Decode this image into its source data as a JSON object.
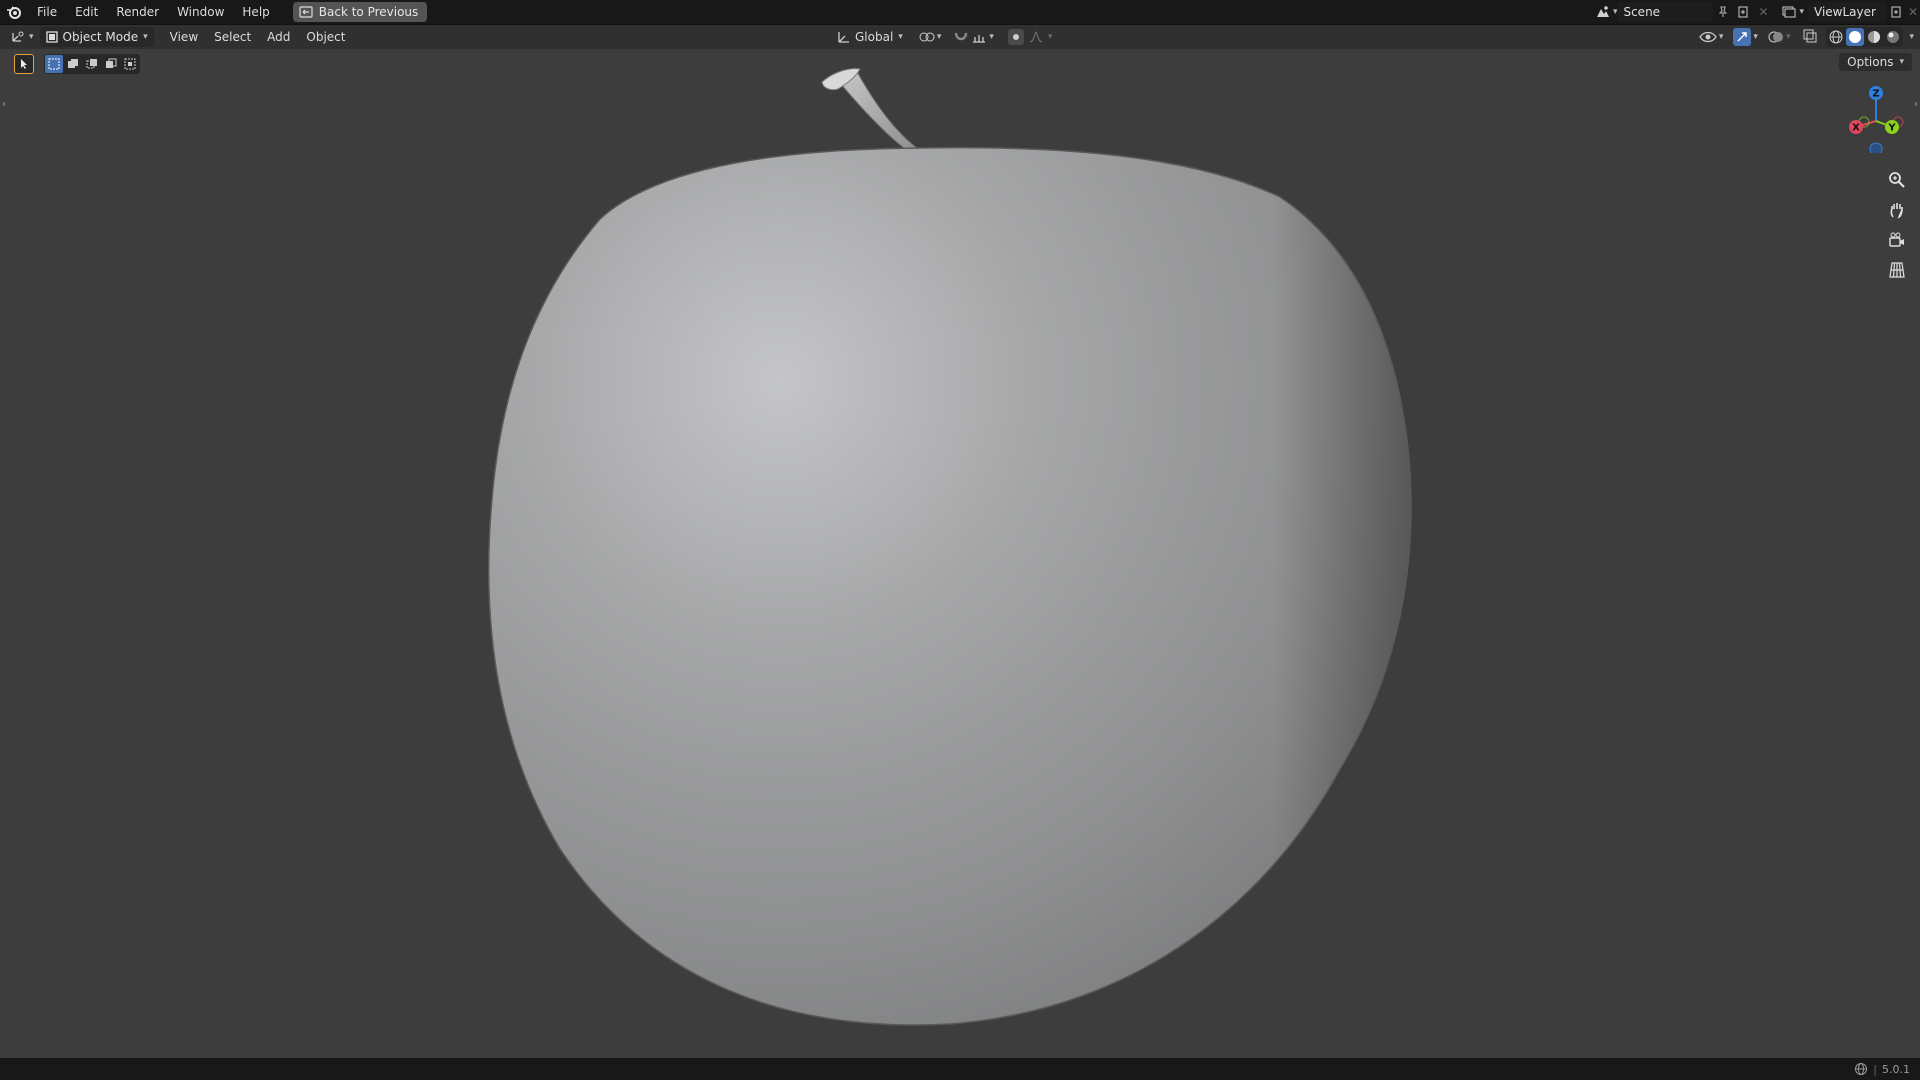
{
  "topbar": {
    "menus": [
      "File",
      "Edit",
      "Render",
      "Window",
      "Help"
    ],
    "back_button": "Back to Previous",
    "scene_name": "Scene",
    "view_layer": "ViewLayer"
  },
  "header": {
    "mode": "Object Mode",
    "menus": [
      "View",
      "Select",
      "Add",
      "Object"
    ],
    "transform_orientation": "Global"
  },
  "viewport": {
    "options_label": "Options",
    "gizmo": {
      "z": "Z",
      "x": "X",
      "y": "Y"
    },
    "object": "apple mesh"
  },
  "statusbar": {
    "version": "5.0.1"
  },
  "colors": {
    "accent": "#4772b3",
    "axis_x": "#e0475c",
    "axis_y": "#8bd11d",
    "axis_z": "#2f7fe0"
  }
}
